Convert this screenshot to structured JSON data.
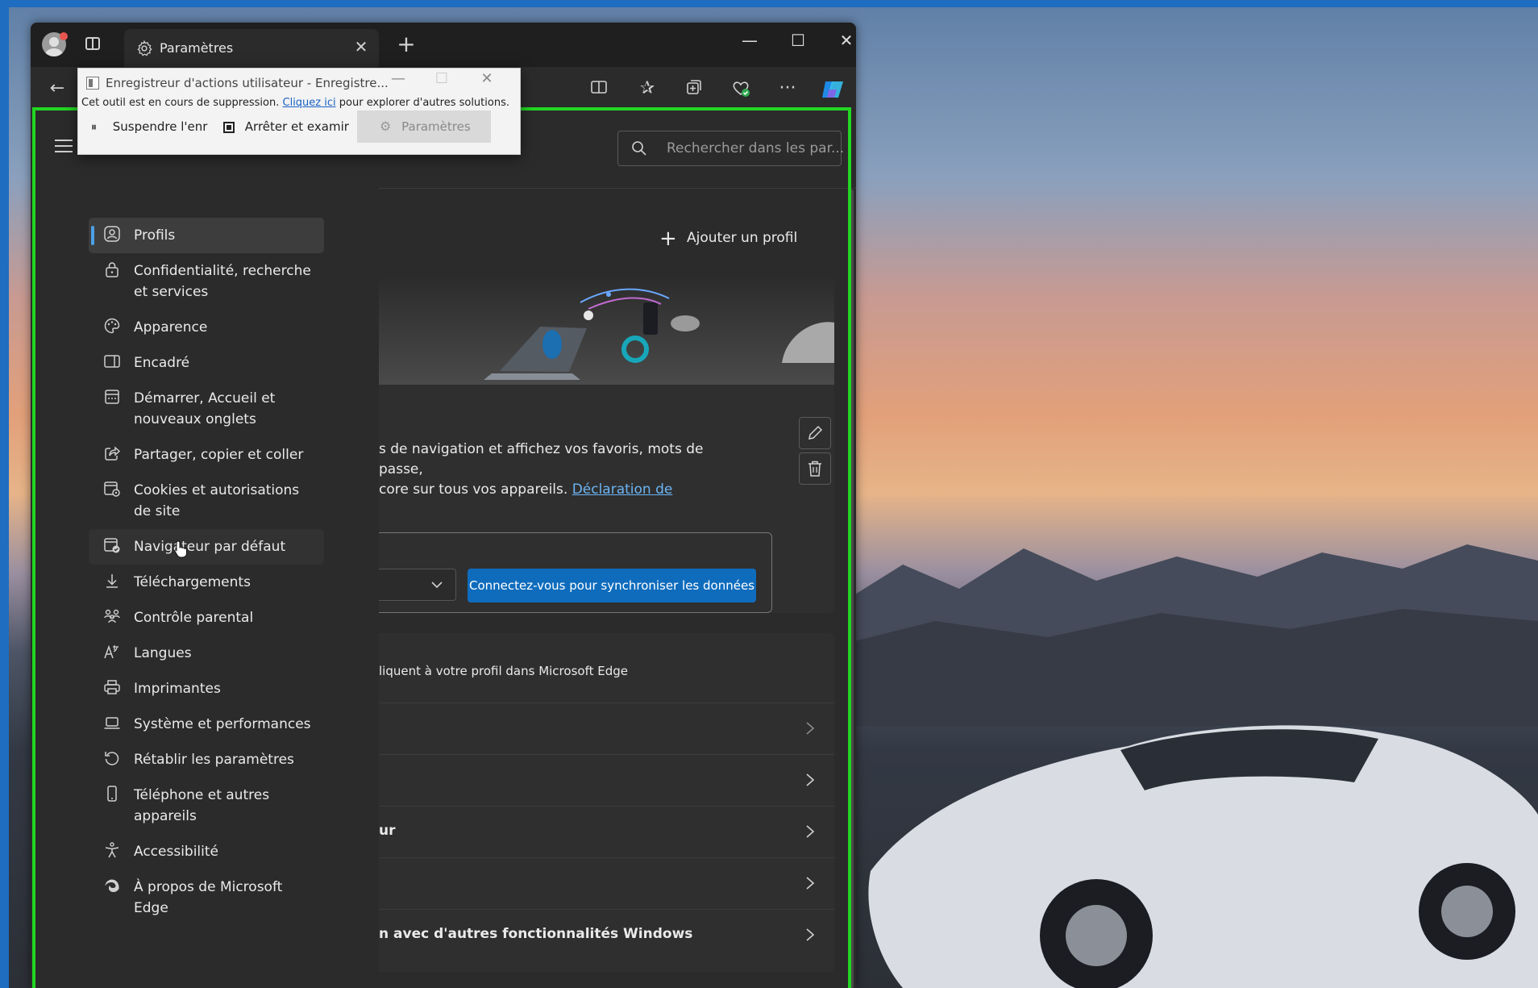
{
  "browser": {
    "tab_title": "Paramètres",
    "new_tab_symbol": "+",
    "close_symbol": "✕",
    "more_symbol": "···"
  },
  "recorder": {
    "title": "Enregistreur d'actions utilisateur - Enregistre...",
    "warning_prefix": "Cet outil est en cours de suppression.",
    "warning_link": "Cliquez ici",
    "warning_suffix": "pour explorer d'autres solutions.",
    "pause_label": "Suspendre l'enr",
    "stop_label": "Arrêter et examir",
    "settings_label": "Paramètres"
  },
  "sidebar": {
    "items": [
      {
        "label": "Profils",
        "icon": "profile-icon",
        "active": true
      },
      {
        "label": "Confidentialité, recherche et services",
        "icon": "lock-icon"
      },
      {
        "label": "Apparence",
        "icon": "palette-icon"
      },
      {
        "label": "Encadré",
        "icon": "sidebar-icon"
      },
      {
        "label": "Démarrer, Accueil et nouveaux onglets",
        "icon": "home-tabs-icon"
      },
      {
        "label": "Partager, copier et coller",
        "icon": "share-icon"
      },
      {
        "label": "Cookies et autorisations de site",
        "icon": "cookies-icon"
      },
      {
        "label": "Navigateur par défaut",
        "icon": "default-browser-icon"
      },
      {
        "label": "Téléchargements",
        "icon": "download-icon"
      },
      {
        "label": "Contrôle parental",
        "icon": "family-icon"
      },
      {
        "label": "Langues",
        "icon": "language-icon"
      },
      {
        "label": "Imprimantes",
        "icon": "printer-icon"
      },
      {
        "label": "Système et performances",
        "icon": "laptop-icon"
      },
      {
        "label": "Rétablir les paramètres",
        "icon": "reset-icon"
      },
      {
        "label": "Téléphone et autres appareils",
        "icon": "phone-icon"
      },
      {
        "label": "Accessibilité",
        "icon": "accessibility-icon"
      },
      {
        "label": "À propos de Microsoft Edge",
        "icon": "edge-icon"
      }
    ]
  },
  "main": {
    "search_placeholder": "Rechercher dans les par...",
    "add_profile_label": "Ajouter un profil",
    "profile_text_line1": "s de navigation et affichez vos favoris, mots de passe,",
    "profile_text_line2": "core sur tous vos appareils.",
    "profile_text_link": "Déclaration de",
    "sync_button_label": "Connectez-vous pour synchroniser les données",
    "settings_desc": "liquent à votre profil dans Microsoft Edge",
    "rows": [
      {
        "label": ""
      },
      {
        "label": ""
      },
      {
        "label": "ur"
      },
      {
        "label": ""
      },
      {
        "label": "n avec d'autres fonctionnalités Windows"
      }
    ]
  }
}
